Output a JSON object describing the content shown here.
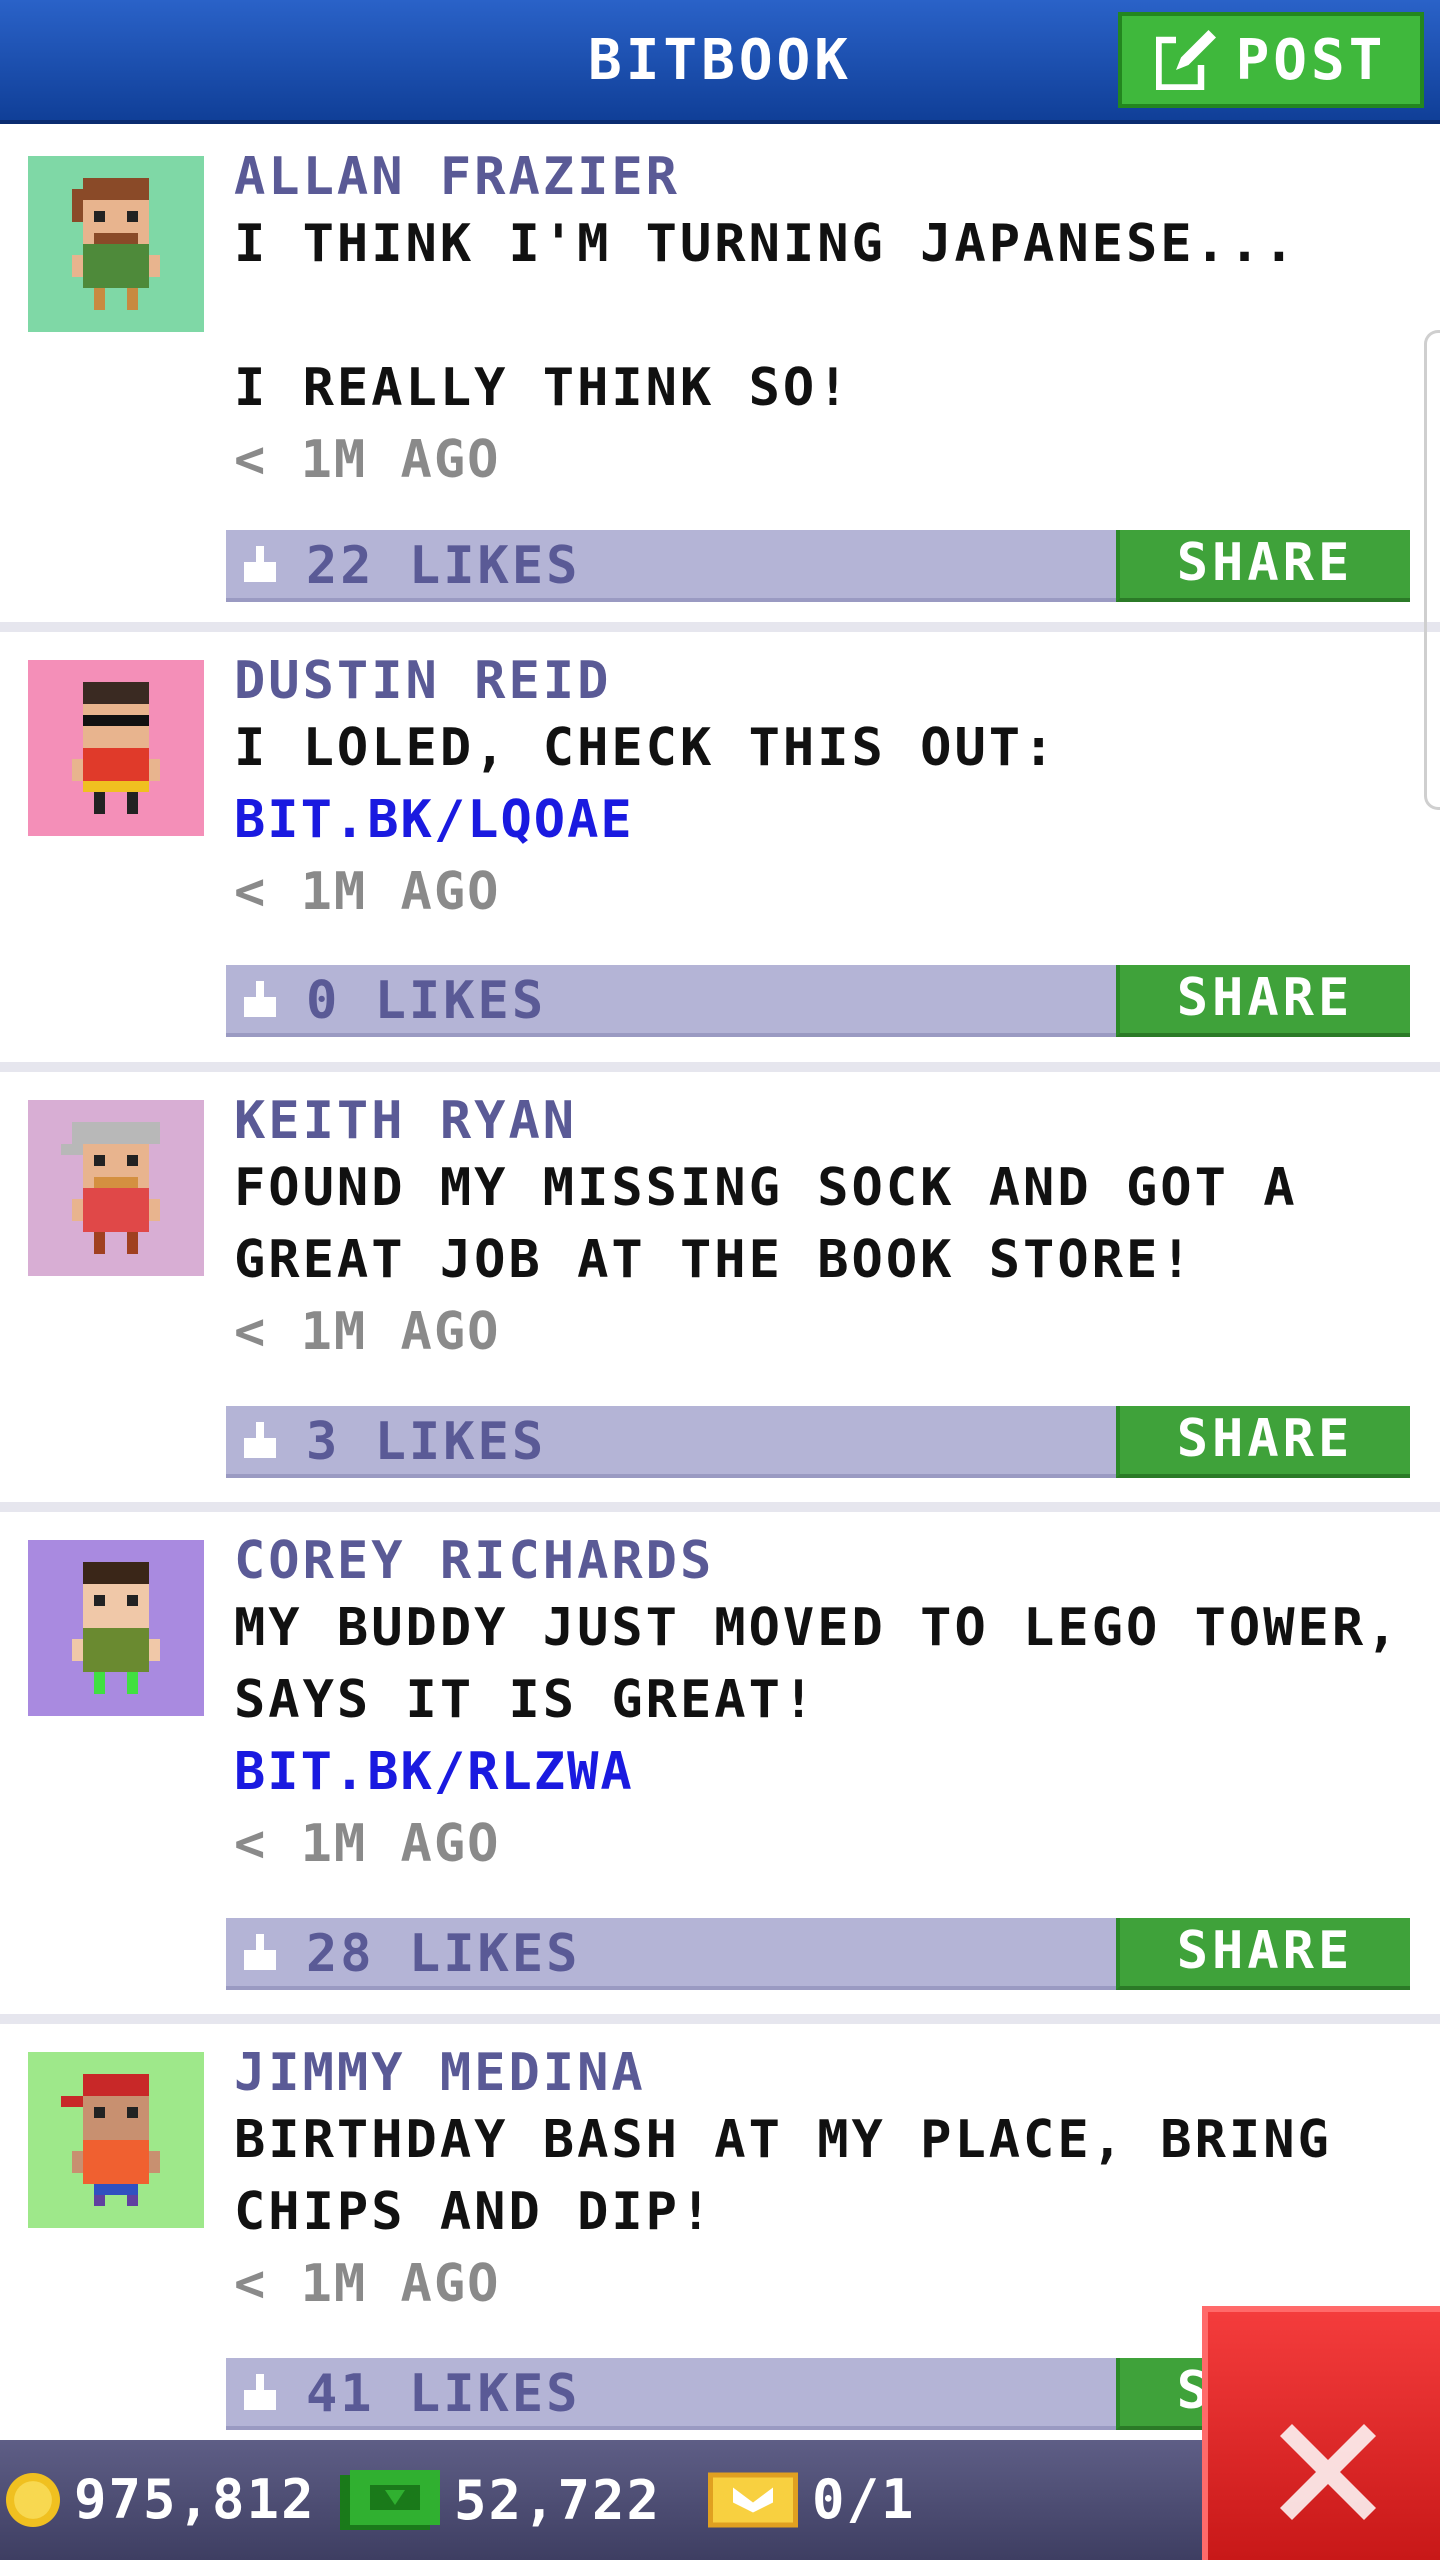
{
  "header": {
    "title": "BITBOOK",
    "post_label": "POST"
  },
  "posts": [
    {
      "name": "ALLAN FRAZIER",
      "message": "I THINK I'M TURNING JAPANESE...\n\nI REALLY THINK SO!",
      "link": "",
      "time": "< 1M AGO",
      "likes": "22 LIKES",
      "share_label": "SHARE",
      "avatar_bg": "#7fd8a6"
    },
    {
      "name": "DUSTIN REID",
      "message": "I LOLED, CHECK THIS OUT:",
      "link": "BIT.BK/LQOAE",
      "time": "< 1M AGO",
      "likes": "0 LIKES",
      "share_label": "SHARE",
      "avatar_bg": "#f48fb8"
    },
    {
      "name": "KEITH RYAN",
      "message": "FOUND MY MISSING SOCK AND GOT A GREAT JOB AT THE BOOK STORE!",
      "link": "",
      "time": "< 1M AGO",
      "likes": "3 LIKES",
      "share_label": "SHARE",
      "avatar_bg": "#d8aed4"
    },
    {
      "name": "COREY RICHARDS",
      "message": "MY BUDDY JUST MOVED TO LEGO TOWER, SAYS IT IS GREAT!",
      "link": "BIT.BK/RLZWA",
      "time": "< 1M AGO",
      "likes": "28 LIKES",
      "share_label": "SHARE",
      "avatar_bg": "#a98ae0"
    },
    {
      "name": "JIMMY MEDINA",
      "message": "BIRTHDAY BASH AT MY PLACE, BRING CHIPS AND DIP!",
      "link": "",
      "time": "< 1M AGO",
      "likes": "41 LIKES",
      "share_label": "SHARE",
      "avatar_bg": "#9ee88a"
    }
  ],
  "bottom": {
    "coins": "975,812",
    "bux": "52,722",
    "tickets": "0/1"
  },
  "icons": {
    "post": "edit-icon",
    "like": "thumbs-up-icon",
    "coin": "coin-icon",
    "bux": "bux-icon",
    "ticket": "ticket-icon",
    "close": "close-icon"
  },
  "colors": {
    "header": "#1d50b0",
    "share": "#3fa23a",
    "like_bar": "#b4b4d6",
    "link": "#1a1ae0",
    "close": "#e02828"
  }
}
